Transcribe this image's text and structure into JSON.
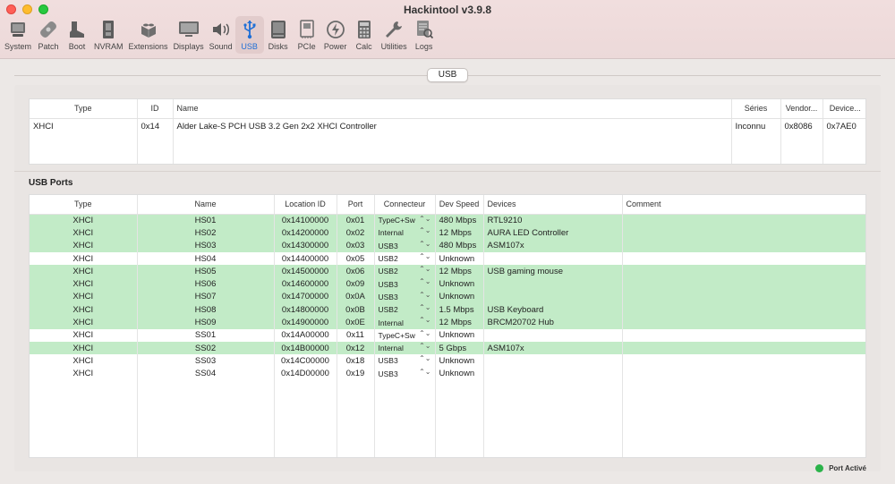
{
  "window": {
    "title": "Hackintool v3.9.8",
    "toolbar": [
      {
        "label": "System",
        "icon": "monitor-icon"
      },
      {
        "label": "Patch",
        "icon": "bandage-icon"
      },
      {
        "label": "Boot",
        "icon": "boot-icon"
      },
      {
        "label": "NVRAM",
        "icon": "chip-icon"
      },
      {
        "label": "Extensions",
        "icon": "lego-icon"
      },
      {
        "label": "Displays",
        "icon": "display-icon"
      },
      {
        "label": "Sound",
        "icon": "speaker-icon"
      },
      {
        "label": "USB",
        "icon": "usb-icon"
      },
      {
        "label": "Disks",
        "icon": "disk-icon"
      },
      {
        "label": "PCIe",
        "icon": "card-icon"
      },
      {
        "label": "Power",
        "icon": "power-icon"
      },
      {
        "label": "Calc",
        "icon": "calculator-icon"
      },
      {
        "label": "Utilities",
        "icon": "wrench-icon"
      },
      {
        "label": "Logs",
        "icon": "logs-icon"
      }
    ],
    "active_tab": "USB"
  },
  "segment": {
    "label": "USB"
  },
  "controllers": {
    "headers": [
      "Type",
      "ID",
      "Name",
      "Séries",
      "Vendor...",
      "Device..."
    ],
    "rows": [
      [
        "XHCI",
        "0x14",
        "Alder Lake-S PCH USB 3.2 Gen 2x2 XHCI Controller",
        "Inconnu",
        "0x8086",
        "0x7AE0"
      ]
    ]
  },
  "ports": {
    "title": "USB Ports",
    "headers": [
      "Type",
      "Name",
      "Location ID",
      "Port",
      "Connecteur",
      "Dev Speed",
      "Devices",
      "Comment"
    ],
    "rows": [
      {
        "type": "XHCI",
        "name": "HS01",
        "location": "0x14100000",
        "port": "0x01",
        "connector": "TypeC+Sw",
        "speed": "480 Mbps",
        "device": "RTL9210",
        "comment": "",
        "active": true
      },
      {
        "type": "XHCI",
        "name": "HS02",
        "location": "0x14200000",
        "port": "0x02",
        "connector": "Internal",
        "speed": "12 Mbps",
        "device": "AURA LED Controller",
        "comment": "",
        "active": true
      },
      {
        "type": "XHCI",
        "name": "HS03",
        "location": "0x14300000",
        "port": "0x03",
        "connector": "USB3",
        "speed": "480 Mbps",
        "device": "ASM107x",
        "comment": "",
        "active": true
      },
      {
        "type": "XHCI",
        "name": "HS04",
        "location": "0x14400000",
        "port": "0x05",
        "connector": "USB2",
        "speed": "Unknown",
        "device": "",
        "comment": "",
        "active": false
      },
      {
        "type": "XHCI",
        "name": "HS05",
        "location": "0x14500000",
        "port": "0x06",
        "connector": "USB2",
        "speed": "12 Mbps",
        "device": "USB gaming mouse",
        "comment": "",
        "active": true
      },
      {
        "type": "XHCI",
        "name": "HS06",
        "location": "0x14600000",
        "port": "0x09",
        "connector": "USB3",
        "speed": "Unknown",
        "device": "",
        "comment": "",
        "active": true
      },
      {
        "type": "XHCI",
        "name": "HS07",
        "location": "0x14700000",
        "port": "0x0A",
        "connector": "USB3",
        "speed": "Unknown",
        "device": "",
        "comment": "",
        "active": true
      },
      {
        "type": "XHCI",
        "name": "HS08",
        "location": "0x14800000",
        "port": "0x0B",
        "connector": "USB2",
        "speed": "1.5 Mbps",
        "device": "USB Keyboard",
        "comment": "",
        "active": true
      },
      {
        "type": "XHCI",
        "name": "HS09",
        "location": "0x14900000",
        "port": "0x0E",
        "connector": "Internal",
        "speed": "12 Mbps",
        "device": "BRCM20702 Hub",
        "comment": "",
        "active": true
      },
      {
        "type": "XHCI",
        "name": "SS01",
        "location": "0x14A00000",
        "port": "0x11",
        "connector": "TypeC+Sw",
        "speed": "Unknown",
        "device": "",
        "comment": "",
        "active": false
      },
      {
        "type": "XHCI",
        "name": "SS02",
        "location": "0x14B00000",
        "port": "0x12",
        "connector": "Internal",
        "speed": "5 Gbps",
        "device": "ASM107x",
        "comment": "",
        "active": true
      },
      {
        "type": "XHCI",
        "name": "SS03",
        "location": "0x14C00000",
        "port": "0x18",
        "connector": "USB3",
        "speed": "Unknown",
        "device": "",
        "comment": "",
        "active": false
      },
      {
        "type": "XHCI",
        "name": "SS04",
        "location": "0x14D00000",
        "port": "0x19",
        "connector": "USB3",
        "speed": "Unknown",
        "device": "",
        "comment": "",
        "active": false
      }
    ]
  },
  "legend": {
    "label": "Port Activé",
    "color": "#2bb34a"
  },
  "colors": {
    "active_row": "#c2ebc7",
    "accent": "#1f6fd6"
  }
}
